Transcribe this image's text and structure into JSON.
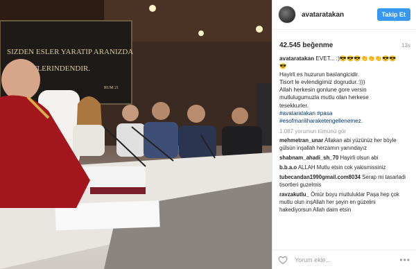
{
  "post": {
    "username": "avataratakan",
    "follow_label": "Takip Et",
    "likes": "42.545 beğenme",
    "time": "13s",
    "caption_user": "avataratakan",
    "caption_lines": [
      " EVET... :)😎😎😎👏👏👏😎😎",
      "😎",
      "Hayirli es huzurun baslangicidir.",
      "Tisort le evlendigimiz dogrudur.:)))",
      "Allah herkesin gonlune gore versin",
      "mutlulugumuzla mutlu olan herkese",
      "tesekkurler."
    ],
    "hashtags": [
      "#avataratakan #pasa",
      "#esofmanliharaketengellenemez."
    ],
    "more_comments": "1.087 yorumun tümünü gör",
    "comments": [
      {
        "user": "mehmetran_unar",
        "text": " Allakan abi yüzünüz her böyle gülsün inşallah herzamın yanındayız"
      },
      {
        "user": "shabnam_ahadi_sh_70",
        "text": " Hayirli olsun abi"
      },
      {
        "user": "b.b.a.o",
        "text": " ALLAH Mutlu etsin cok yakismissiniz"
      },
      {
        "user": "tubecandan1990gmail.com8034",
        "text": " Serap mi tasarladi tisortleri guzelmis"
      },
      {
        "user": "ravzakutlu_",
        "text": " Ömür boyu mutluluklar Paşa hep çok mutlu olun inşAllah her şeyin en güzelini hakediyorsun Allah daim etsin"
      }
    ],
    "comment_placeholder": "Yorum ekle...",
    "more_icon": "•••"
  },
  "photo": {
    "bg_wall": "SIZDEN ESLER YARATIP ARANIZDA ... AYETLER VARDIR ... ETLERINDENDIR.",
    "plaque": "RUM 21"
  },
  "colors": {
    "accent": "#3897f0",
    "hashtag": "#003569"
  }
}
